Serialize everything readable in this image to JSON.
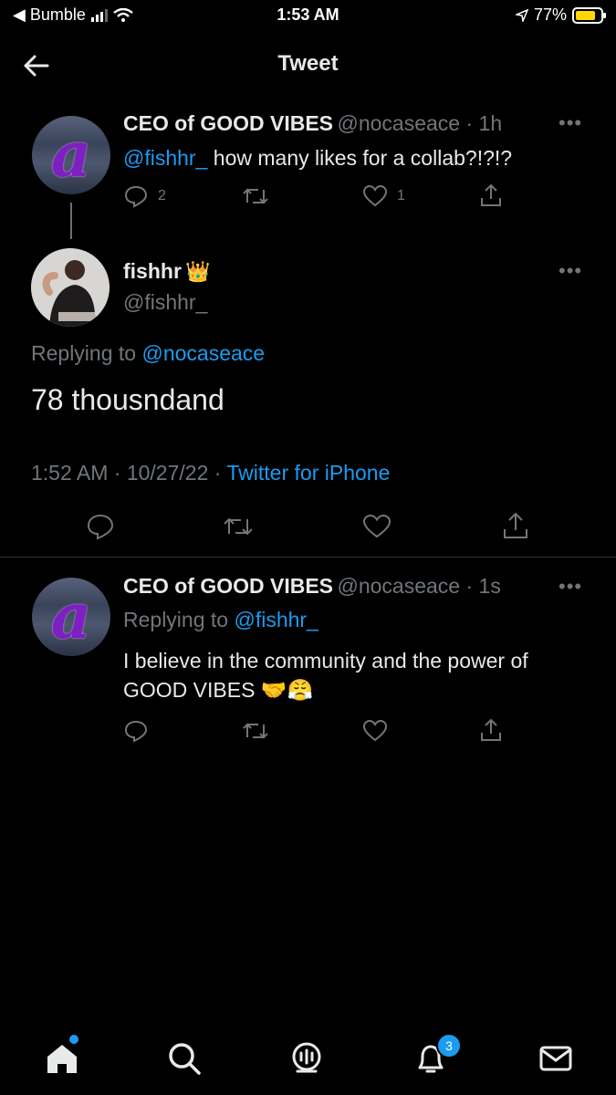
{
  "status_bar": {
    "back_app": "◀ Bumble",
    "time": "1:53 AM",
    "battery": "77%"
  },
  "header": {
    "title": "Tweet"
  },
  "tweets": {
    "parent": {
      "avatar_letter": "a",
      "name": "CEO of GOOD VIBES",
      "handle_time": "@nocaseace · 1h",
      "mention": "@fishhr_",
      "text": " how many likes for a collab?!?!?",
      "replies": "2",
      "retweets": "",
      "likes": "1"
    },
    "main": {
      "name": "fishhr",
      "name_emoji": "👑",
      "handle": "@fishhr_",
      "replying_prefix": "Replying to ",
      "replying_to": "@nocaseace",
      "text": "78 thousndand",
      "timestamp": "1:52 AM · 10/27/22 · ",
      "client": "Twitter for iPhone"
    },
    "reply": {
      "avatar_letter": "a",
      "name": "CEO of GOOD VIBES",
      "handle_time": "@nocaseace · 1s",
      "replying_prefix": "Replying to ",
      "replying_to": "@fishhr_",
      "text_line1": "I believe in the community and the power of",
      "text_line2": "GOOD VIBES 🤝😤"
    }
  },
  "bottom_nav": {
    "notifications_badge": "3"
  },
  "colors": {
    "accent": "#1d9bf0",
    "muted": "#71767b",
    "text": "#e7e9ea",
    "background": "#000000"
  }
}
